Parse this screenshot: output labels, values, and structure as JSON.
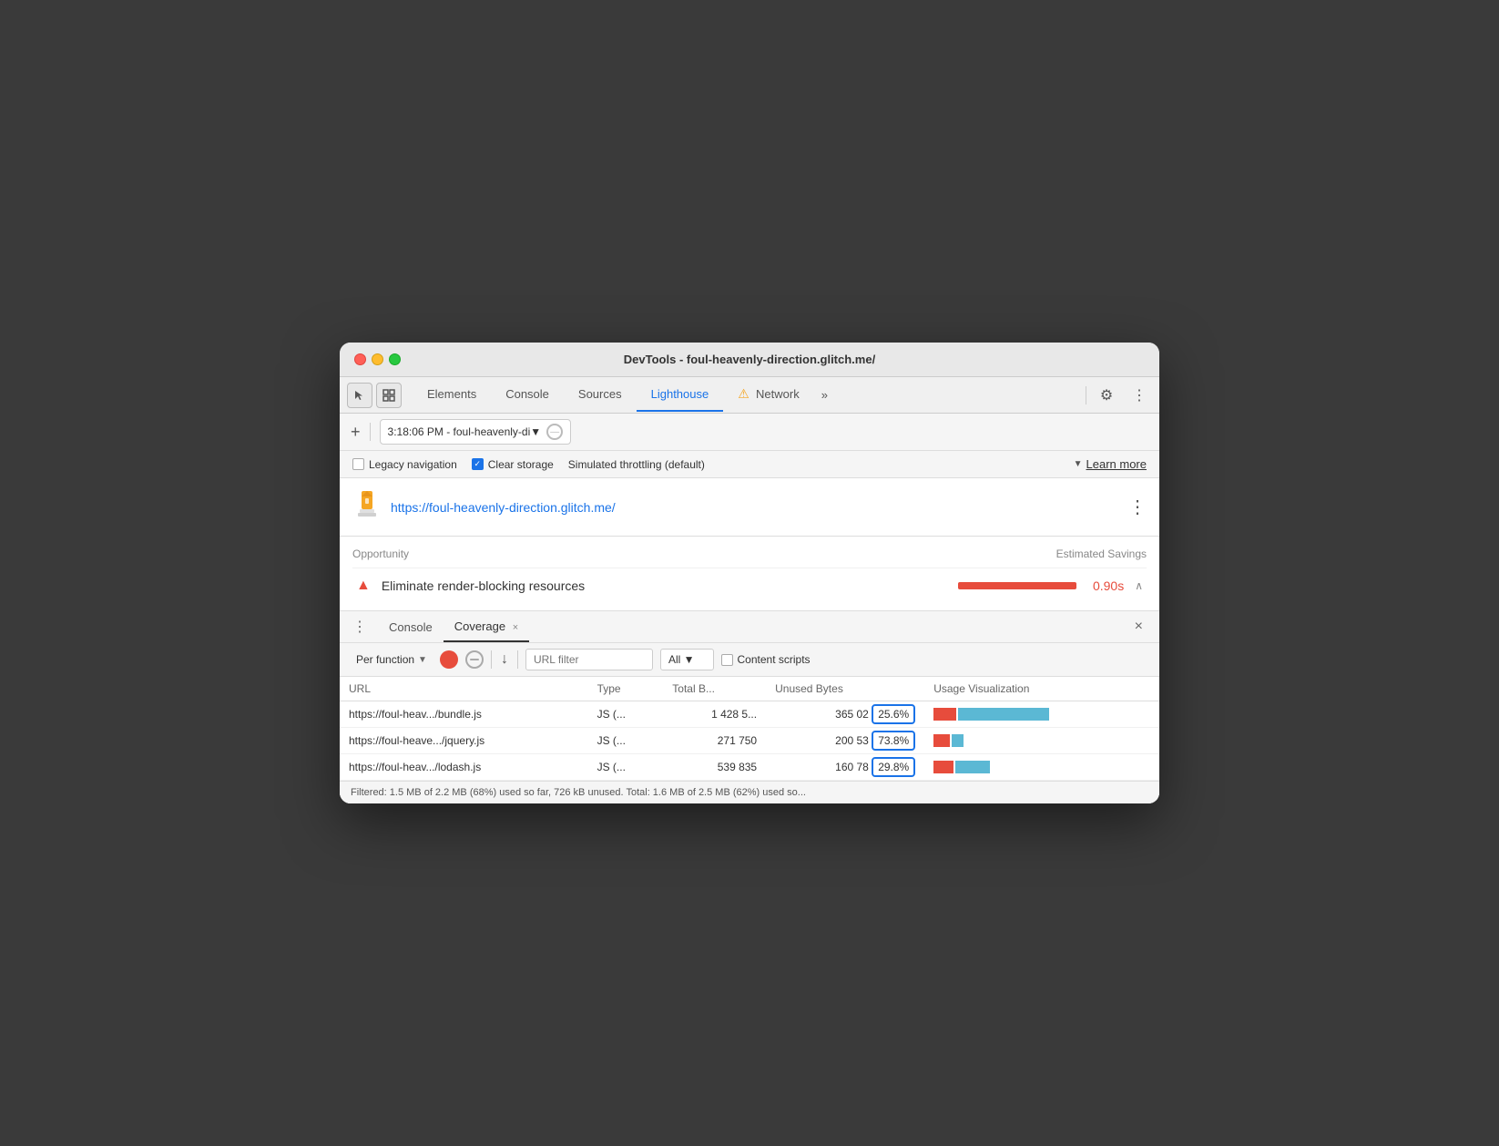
{
  "window": {
    "title": "DevTools - foul-heavenly-direction.glitch.me/"
  },
  "tabs": {
    "items": [
      {
        "id": "elements",
        "label": "Elements",
        "active": false
      },
      {
        "id": "console",
        "label": "Console",
        "active": false
      },
      {
        "id": "sources",
        "label": "Sources",
        "active": false
      },
      {
        "id": "lighthouse",
        "label": "Lighthouse",
        "active": true
      },
      {
        "id": "network",
        "label": "Network",
        "active": false
      }
    ],
    "more_label": "»"
  },
  "toolbar": {
    "plus_label": "+",
    "url_text": "3:18:06 PM - foul-heavenly-di▼",
    "no_entry_label": "⊘"
  },
  "options": {
    "legacy_nav_label": "Legacy navigation",
    "clear_storage_label": "Clear storage",
    "throttling_label": "Simulated throttling (default)",
    "learn_more_label": "Learn more"
  },
  "lighthouse_section": {
    "icon": "🏠",
    "url": "https://foul-heavenly-direction.glitch.me/",
    "dots_label": "⋮"
  },
  "opportunity": {
    "header_left": "Opportunity",
    "header_right": "Estimated Savings",
    "row": {
      "text": "Eliminate render-blocking resources",
      "time": "0.90s"
    }
  },
  "coverage_panel": {
    "panel_dots": "⋮",
    "console_tab": "Console",
    "coverage_tab": "Coverage",
    "close_x": "×",
    "panel_close": "×",
    "per_function_label": "Per function",
    "url_filter_placeholder": "URL filter",
    "all_label": "All",
    "content_scripts_label": "Content scripts",
    "table": {
      "headers": [
        "URL",
        "Type",
        "Total B...",
        "Unused Bytes",
        "Usage Visualization"
      ],
      "rows": [
        {
          "url": "https://foul-heav.../bundle.js",
          "type": "JS (...",
          "total": "1 428 5...",
          "unused_bytes": "365 02",
          "unused_pct": "25.6%",
          "highlight": true,
          "used_pct": 25.6,
          "bar_used_w": 20,
          "bar_unused_w": 80
        },
        {
          "url": "https://foul-heave.../jquery.js",
          "type": "JS (...",
          "total": "271 750",
          "unused_bytes": "200 53",
          "unused_pct": "73.8%",
          "highlight": true,
          "used_pct": 73.8,
          "bar_used_w": 20,
          "bar_unused_w": 15
        },
        {
          "url": "https://foul-heav.../lodash.js",
          "type": "JS (...",
          "total": "539 835",
          "unused_bytes": "160 78",
          "unused_pct": "29.8%",
          "highlight": true,
          "used_pct": 29.8,
          "bar_used_w": 22,
          "bar_unused_w": 40
        }
      ]
    },
    "footer": "Filtered: 1.5 MB of 2.2 MB (68%) used so far, 726 kB unused. Total: 1.6 MB of 2.5 MB (62%) used so..."
  },
  "colors": {
    "active_tab": "#1a73e8",
    "error_red": "#e74c3c",
    "bar_used": "#e74c3c",
    "bar_unused": "#5bb8d4",
    "highlight_border": "#1a73e8"
  }
}
